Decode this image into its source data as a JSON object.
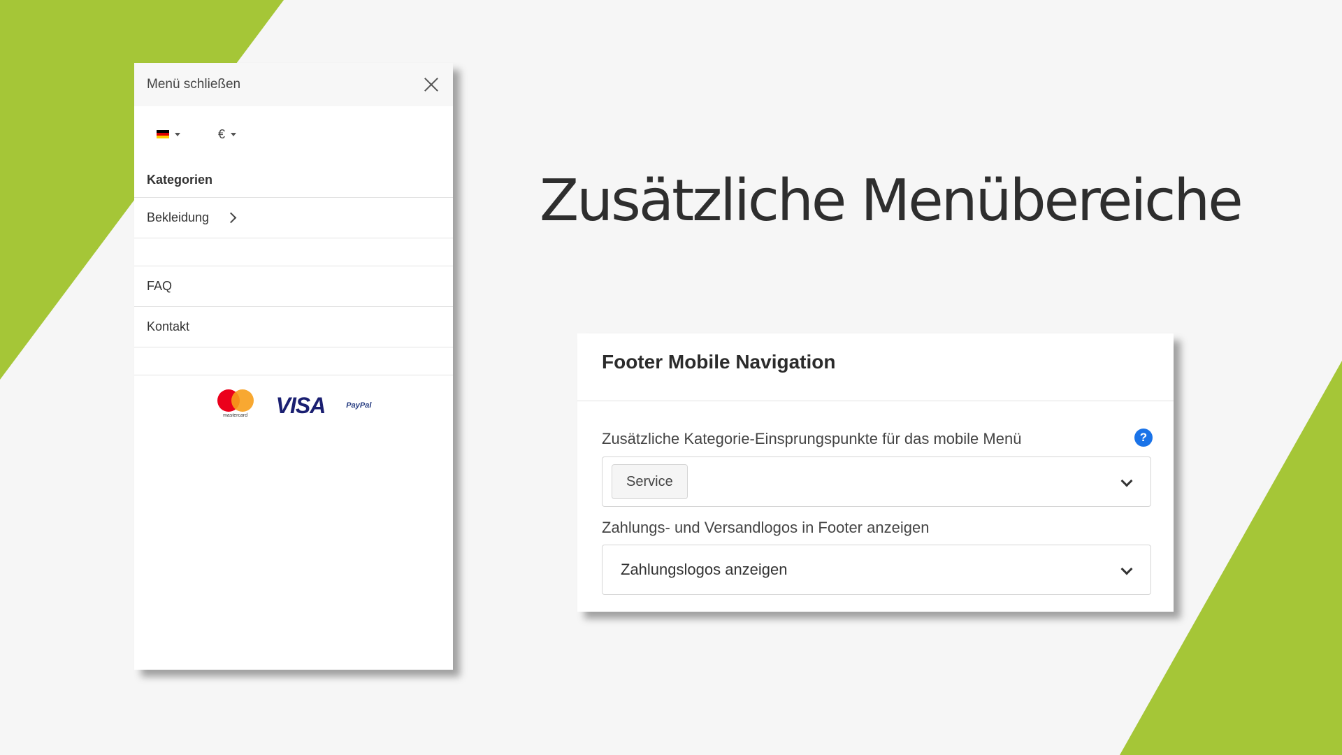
{
  "colors": {
    "accent_green": "#a5c637",
    "background": "#f6f6f6",
    "help_blue": "#1a73e8"
  },
  "slide": {
    "title": "Zusätzliche Menübereiche"
  },
  "mobile_menu": {
    "close_label": "Menü schließen",
    "language_flag": "de-flag-icon",
    "currency_symbol": "€",
    "categories_heading": "Kategorien",
    "category_items": [
      {
        "label": "Bekleidung",
        "icon": "chevron-right-icon"
      }
    ],
    "extra_items": [
      {
        "label": "FAQ"
      },
      {
        "label": "Kontakt"
      }
    ],
    "payment_logos": {
      "mastercard_text": "mastercard",
      "visa_text": "VISA",
      "paypal_text": "PayPal"
    }
  },
  "settings_card": {
    "title": "Footer Mobile Navigation",
    "fields": [
      {
        "label": "Zusätzliche Kategorie-Einsprungspunkte für das mobile Menü",
        "selected_tag": "Service",
        "help_icon": "?"
      },
      {
        "label": "Zahlungs- und Versandlogos in Footer anzeigen",
        "value": "Zahlungslogos anzeigen"
      }
    ]
  }
}
